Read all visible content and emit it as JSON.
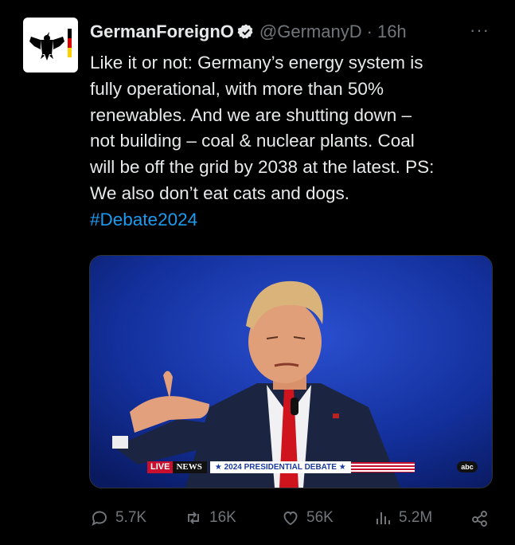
{
  "account": {
    "display_name": "GermanForeignO",
    "handle": "@GermanyD",
    "separator": "·",
    "time": "16h",
    "more": "···",
    "verified_icon": "verified-badge-icon",
    "avatar_icon": "german-eagle-crest-icon"
  },
  "tweet": {
    "lines": [
      "Like it or not: Germany’s energy system is",
      "fully operational, with more than 50%",
      "renewables. And we are shutting down –",
      "not building – coal & nuclear plants. Coal",
      "will be off the grid by 2038 at the latest. PS:",
      "We also don’t eat cats and dogs."
    ],
    "hashtag": "#Debate2024"
  },
  "media": {
    "ticker": {
      "live": "LIVE",
      "network": "NEWS",
      "banner": "★ 2024 PRESIDENTIAL DEBATE ★"
    },
    "corner_logo": "abc"
  },
  "actions": {
    "replies": "5.7K",
    "reposts": "16K",
    "likes": "56K",
    "views": "5.2M"
  },
  "colors": {
    "background": "#000000",
    "text": "#e7e9ea",
    "muted": "#71767b",
    "link": "#1d9bf0",
    "verified": "#ffffff"
  }
}
